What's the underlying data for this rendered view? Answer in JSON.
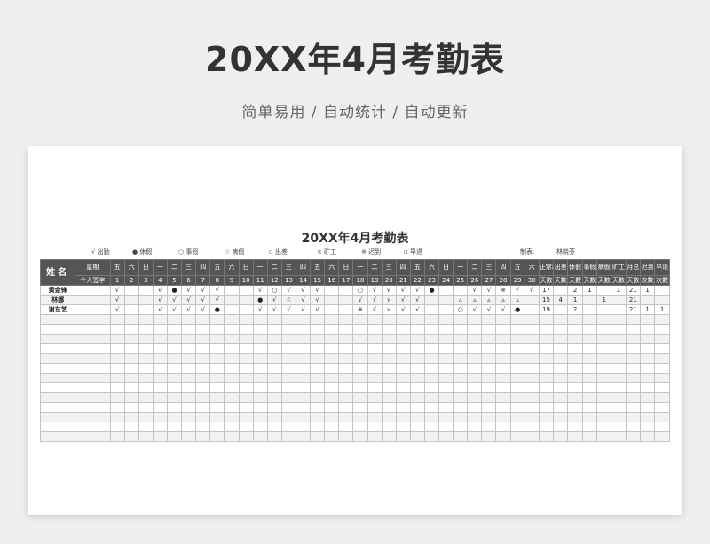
{
  "hero": {
    "title": "20XX年4月考勤表",
    "subtitle": "简单易用  /  自动统计  /  自动更新"
  },
  "sheet": {
    "title": "20XX年4月考勤表",
    "legend": [
      {
        "symbol": "√",
        "label": "出勤"
      },
      {
        "symbol": "●",
        "label": "休假"
      },
      {
        "symbol": "○",
        "label": "事假"
      },
      {
        "symbol": "☆",
        "label": "病假"
      },
      {
        "symbol": "▫",
        "label": "出差"
      },
      {
        "symbol": "×",
        "label": "旷工"
      },
      {
        "symbol": "※",
        "label": "迟到"
      },
      {
        "symbol": "▫",
        "label": "早退"
      }
    ],
    "preparer_label": "制表:",
    "preparer_name": "林晓芬",
    "header": {
      "name": "姓名",
      "weekday_label": "星期",
      "id_label": "个人签字",
      "weekdays": [
        "五",
        "六",
        "日",
        "一",
        "二",
        "三",
        "四",
        "五",
        "六",
        "日",
        "一",
        "二",
        "三",
        "四",
        "五",
        "六",
        "日",
        "一",
        "二",
        "三",
        "四",
        "五",
        "六",
        "日",
        "一",
        "二",
        "三",
        "四",
        "五",
        "六"
      ],
      "days": [
        "1",
        "2",
        "3",
        "4",
        "5",
        "6",
        "7",
        "8",
        "9",
        "10",
        "11",
        "12",
        "13",
        "14",
        "15",
        "16",
        "17",
        "18",
        "19",
        "20",
        "21",
        "22",
        "23",
        "24",
        "25",
        "26",
        "27",
        "28",
        "29",
        "30"
      ],
      "stats_top": [
        "正常出勤",
        "出差",
        "休假",
        "事假",
        "病假",
        "旷工",
        "月总",
        "迟到",
        "早退"
      ],
      "stats_bottom": [
        "天数",
        "天数",
        "天数",
        "天数",
        "天数",
        "天数",
        "天数",
        "次数",
        "次数"
      ]
    },
    "rows": [
      {
        "name": "黄金锋",
        "marks": [
          "",
          "",
          "√",
          "",
          "",
          "√",
          "●",
          "√",
          "√",
          "√",
          "",
          "",
          "√",
          "○",
          "√",
          "√",
          "√",
          "",
          "",
          "○",
          "√",
          "√",
          "√",
          "√",
          "●",
          "",
          "",
          "√",
          "√",
          "※",
          "√",
          "√"
        ],
        "stats": [
          "17",
          "",
          "2",
          "1",
          "",
          "1",
          "21",
          "1",
          ""
        ]
      },
      {
        "name": "林娜",
        "marks": [
          "",
          "",
          "√",
          "",
          "",
          "√",
          "√",
          "√",
          "√",
          "√",
          "",
          "",
          "●",
          "√",
          "☆",
          "√",
          "√",
          "",
          "",
          "√",
          "√",
          "√",
          "√",
          "√",
          "",
          "",
          "▵",
          "▵",
          "▵",
          "▵",
          "▵"
        ],
        "stats": [
          "15",
          "4",
          "1",
          "",
          "1",
          "",
          "21",
          "",
          ""
        ]
      },
      {
        "name": "谢左艺",
        "marks": [
          "",
          "",
          "√",
          "",
          "",
          "√",
          "√",
          "√",
          "√",
          "●",
          "",
          "",
          "√",
          "√",
          "√",
          "√",
          "√",
          "",
          "",
          "※",
          "√",
          "√",
          "√",
          "√",
          "",
          "",
          "○",
          "√",
          "√",
          "√",
          "●"
        ],
        "stats": [
          "19",
          "",
          "2",
          "",
          "",
          "",
          "21",
          "1",
          "1"
        ]
      }
    ],
    "empty_rows": 13
  }
}
